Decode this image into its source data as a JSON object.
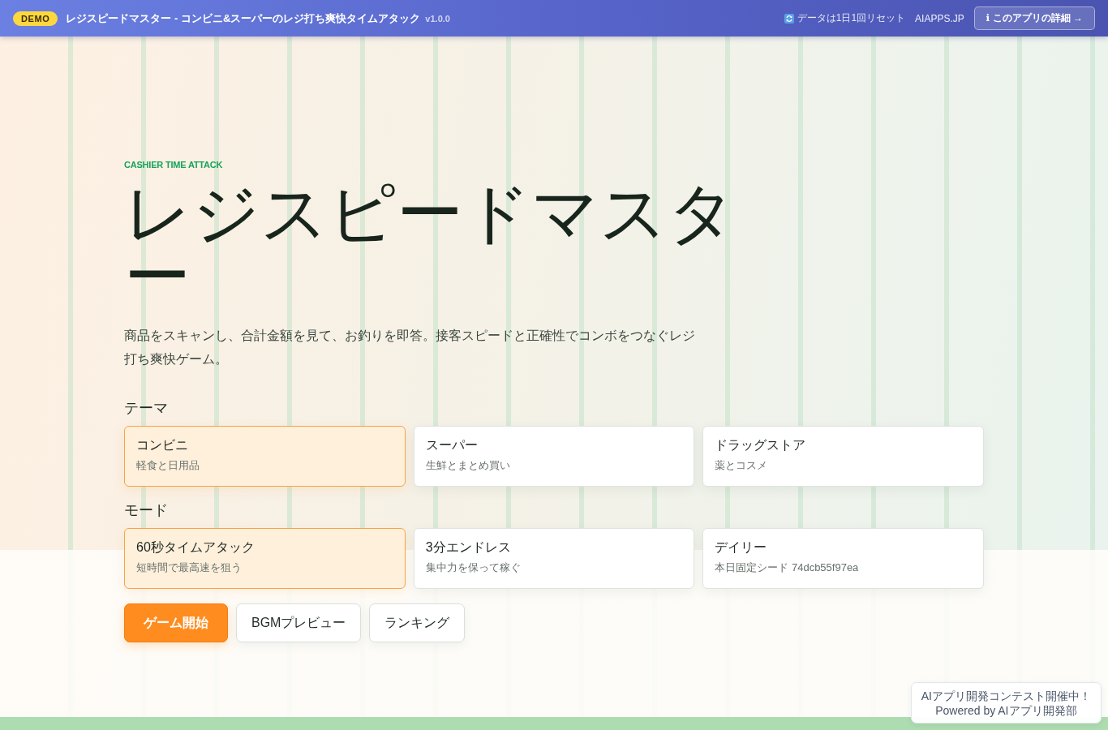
{
  "header": {
    "badge": "DEMO",
    "title": "レジスピードマスター - コンビニ&スーパーのレジ打ち爽快タイムアタック",
    "version": "v1.0.0",
    "reset_note": "データは1日1回リセット",
    "site_link": "AIAPPS.JP",
    "about_button": "ℹ このアプリの詳細 →"
  },
  "hero": {
    "eyebrow": "CASHIER TIME ATTACK",
    "title": "レジスピードマスター",
    "description": "商品をスキャンし、合計金額を見て、お釣りを即答。接客スピードと正確性でコンボをつなぐレジ打ち爽快ゲーム。"
  },
  "theme": {
    "label": "テーマ",
    "options": [
      {
        "title": "コンビニ",
        "subtitle": "軽食と日用品",
        "selected": true
      },
      {
        "title": "スーパー",
        "subtitle": "生鮮とまとめ買い",
        "selected": false
      },
      {
        "title": "ドラッグストア",
        "subtitle": "薬とコスメ",
        "selected": false
      }
    ]
  },
  "mode": {
    "label": "モード",
    "options": [
      {
        "title": "60秒タイムアタック",
        "subtitle": "短時間で最高速を狙う",
        "selected": true
      },
      {
        "title": "3分エンドレス",
        "subtitle": "集中力を保って稼ぐ",
        "selected": false
      },
      {
        "title": "デイリー",
        "subtitle": "本日固定シード 74dcb55f97ea",
        "selected": false
      }
    ]
  },
  "actions": [
    {
      "label": "ゲーム開始",
      "kind": "primary"
    },
    {
      "label": "BGMプレビュー",
      "kind": "secondary"
    },
    {
      "label": "ランキング",
      "kind": "secondary"
    }
  ],
  "contest_banner": {
    "lines": [
      "AIアプリ開発コンテスト開催中！",
      "Powered by AIアプリ開発部"
    ]
  }
}
